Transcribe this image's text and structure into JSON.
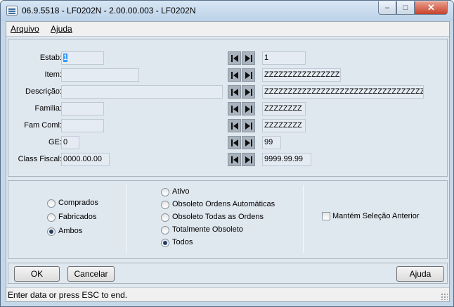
{
  "window": {
    "title": "06.9.5518 - LF0202N - 2.00.00.003 - LF0202N",
    "minimize": "–",
    "maximize": "□",
    "close": "✕"
  },
  "menu": {
    "items": [
      "Arquivo",
      "Ajuda"
    ]
  },
  "filters": [
    {
      "label": "Estab:",
      "from": "1",
      "to": "1"
    },
    {
      "label": "Item:",
      "from": "",
      "to": "ZZZZZZZZZZZZZZZZ"
    },
    {
      "label": "Descrição:",
      "from": "",
      "to": "ZZZZZZZZZZZZZZZZZZZZZZZZZZZZZZZZZZZZZZZZ"
    },
    {
      "label": "Familia:",
      "from": "",
      "to": "ZZZZZZZZ"
    },
    {
      "label": "Fam Coml:",
      "from": "",
      "to": "ZZZZZZZZ"
    },
    {
      "label": "GE:",
      "from": "0",
      "to": "99"
    },
    {
      "label": "Class Fiscal:",
      "from": "0000.00.00",
      "to": "9999.99.99"
    }
  ],
  "icons": {
    "first": "first-record-icon",
    "last": "last-record-icon",
    "window": "app-window-icon",
    "grip": "resize-grip-icon"
  },
  "origin_options": [
    {
      "label": "Comprados",
      "selected": false
    },
    {
      "label": "Fabricados",
      "selected": false
    },
    {
      "label": "Ambos",
      "selected": true
    }
  ],
  "status_options": [
    {
      "label": "Ativo",
      "selected": false
    },
    {
      "label": "Obsoleto Ordens Automáticas",
      "selected": false
    },
    {
      "label": "Obsoleto Todas as Ordens",
      "selected": false
    },
    {
      "label": "Totalmente Obsoleto",
      "selected": false
    },
    {
      "label": "Todos",
      "selected": true
    }
  ],
  "keep_selection": {
    "label": "Mantém Seleção Anterior",
    "checked": false
  },
  "buttons": {
    "ok": "OK",
    "cancel": "Cancelar",
    "help": "Ajuda"
  },
  "status_bar": "Enter data or press ESC to end.",
  "colors": {
    "panel": "#dfe7ef",
    "field": "#e4ebf2",
    "selection": "#3399ff",
    "title_bar": "#c4d8ea",
    "close_button": "#c7422c"
  }
}
